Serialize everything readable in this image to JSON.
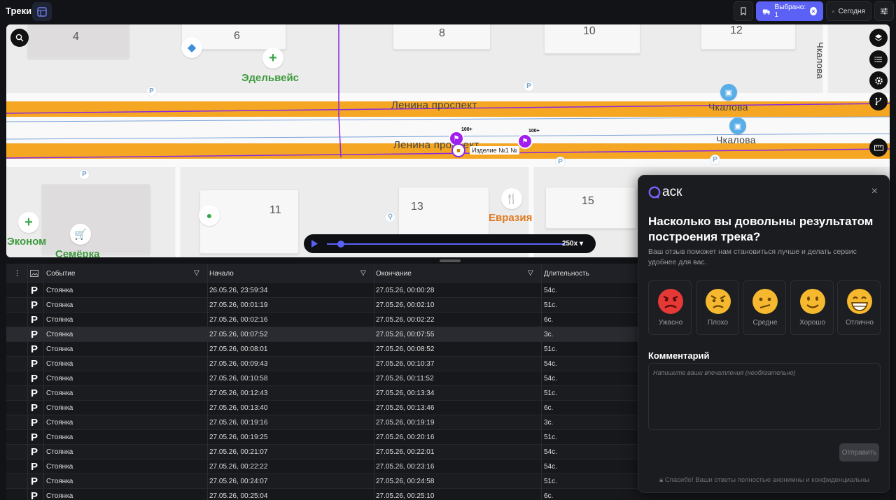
{
  "app": {
    "title": "Треки"
  },
  "toolbar": {
    "selected_label": "Выбрано: 1",
    "today_label": "Сегодня"
  },
  "map": {
    "blocks": [
      "4",
      "6",
      "8",
      "10",
      "12",
      "11",
      "13",
      "15"
    ],
    "street_upper": "Ленина проспект",
    "street_lower": "Ленина проспект",
    "street_right_upper": "Чкалова",
    "street_right_lower": "Чкалова",
    "street_vertical": "Чкалова",
    "poi_edelweiss": "Эдельвейс",
    "poi_econom": "Эконом",
    "poi_semerka": "Семёрка",
    "poi_eurasia": "Евразия",
    "marker_count_1": "100+",
    "marker_count_2": "100+",
    "vehicle_label": "Изделие №1 №",
    "player_speed": "250x",
    "playback_progress": 0.06
  },
  "table": {
    "columns": {
      "event": "Событие",
      "start": "Начало",
      "end": "Окончание",
      "duration": "Длительность"
    },
    "rows": [
      {
        "icon": "P",
        "event": "Стоянка",
        "start": "26.05.26, 23:59:34",
        "end": "27.05.26, 00:00:28",
        "duration": "54с."
      },
      {
        "icon": "P",
        "event": "Стоянка",
        "start": "27.05.26, 00:01:19",
        "end": "27.05.26, 00:02:10",
        "duration": "51с."
      },
      {
        "icon": "P",
        "event": "Стоянка",
        "start": "27.05.26, 00:02:16",
        "end": "27.05.26, 00:02:22",
        "duration": "6с."
      },
      {
        "icon": "P",
        "event": "Стоянка",
        "start": "27.05.26, 00:07:52",
        "end": "27.05.26, 00:07:55",
        "duration": "3с."
      },
      {
        "icon": "P",
        "event": "Стоянка",
        "start": "27.05.26, 00:08:01",
        "end": "27.05.26, 00:08:52",
        "duration": "51с."
      },
      {
        "icon": "P",
        "event": "Стоянка",
        "start": "27.05.26, 00:09:43",
        "end": "27.05.26, 00:10:37",
        "duration": "54с."
      },
      {
        "icon": "P",
        "event": "Стоянка",
        "start": "27.05.26, 00:10:58",
        "end": "27.05.26, 00:11:52",
        "duration": "54с."
      },
      {
        "icon": "P",
        "event": "Стоянка",
        "start": "27.05.26, 00:12:43",
        "end": "27.05.26, 00:13:34",
        "duration": "51с."
      },
      {
        "icon": "P",
        "event": "Стоянка",
        "start": "27.05.26, 00:13:40",
        "end": "27.05.26, 00:13:46",
        "duration": "6с."
      },
      {
        "icon": "P",
        "event": "Стоянка",
        "start": "27.05.26, 00:19:16",
        "end": "27.05.26, 00:19:19",
        "duration": "3с."
      },
      {
        "icon": "P",
        "event": "Стоянка",
        "start": "27.05.26, 00:19:25",
        "end": "27.05.26, 00:20:16",
        "duration": "51с."
      },
      {
        "icon": "P",
        "event": "Стоянка",
        "start": "27.05.26, 00:21:07",
        "end": "27.05.26, 00:22:01",
        "duration": "54с."
      },
      {
        "icon": "P",
        "event": "Стоянка",
        "start": "27.05.26, 00:22:22",
        "end": "27.05.26, 00:23:16",
        "duration": "54с."
      },
      {
        "icon": "P",
        "event": "Стоянка",
        "start": "27.05.26, 00:24:07",
        "end": "27.05.26, 00:24:58",
        "duration": "51с."
      },
      {
        "icon": "P",
        "event": "Стоянка",
        "start": "27.05.26, 00:25:04",
        "end": "27.05.26, 00:25:10",
        "duration": "6с."
      }
    ]
  },
  "survey": {
    "brand": "аск",
    "title": "Насколько вы довольны результатом построения трека?",
    "subtitle": "Ваш отзыв поможет нам становиться лучше и делать сервис удобнее для вас.",
    "ratings": [
      {
        "label": "Ужасно",
        "icon": "angry-face-icon",
        "color": "#e53935"
      },
      {
        "label": "Плохо",
        "icon": "annoyed-face-icon",
        "color": "#f5b82e"
      },
      {
        "label": "Средне",
        "icon": "confused-face-icon",
        "color": "#f5b82e"
      },
      {
        "label": "Хорошо",
        "icon": "smile-face-icon",
        "color": "#f5b82e"
      },
      {
        "label": "Отлично",
        "icon": "grin-face-icon",
        "color": "#f5b82e"
      }
    ],
    "comment_label": "Комментарий",
    "comment_placeholder": "Напишите ваши впечатления (необязательно)",
    "submit_label": "Отправить",
    "footer": "Спасибо! Ваши ответы полностью анонимны и конфиденциальны"
  },
  "colors": {
    "accent": "#5b61f5",
    "road": "#f5a623",
    "route": "#8a2be2"
  }
}
